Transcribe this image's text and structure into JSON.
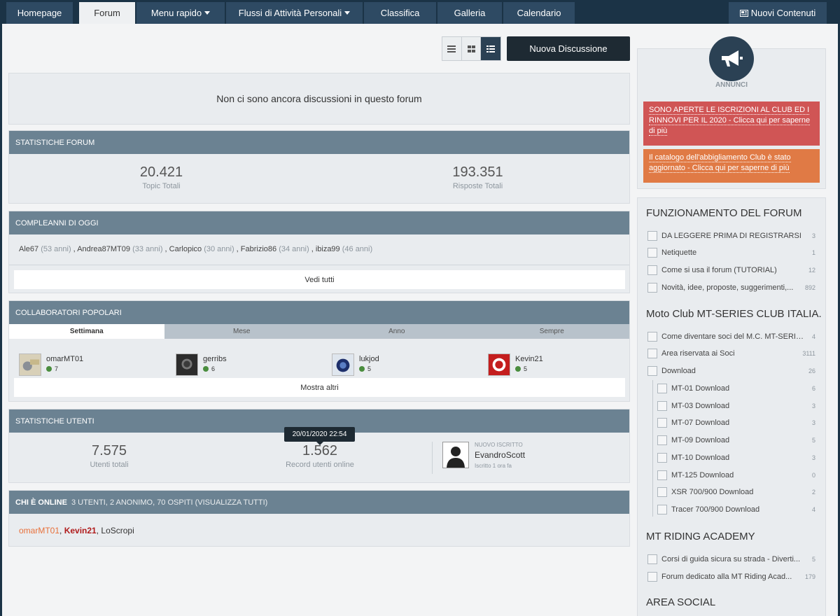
{
  "nav": {
    "tabs": [
      {
        "label": "Homepage"
      },
      {
        "label": "Forum"
      },
      {
        "label": "Menu rapido"
      },
      {
        "label": "Flussi di Attività Personali"
      },
      {
        "label": "Classifica"
      },
      {
        "label": "Galleria"
      },
      {
        "label": "Calendario"
      }
    ],
    "new_content": "Nuovi Contenuti"
  },
  "toolbar": {
    "new_topic": "Nuova Discussione"
  },
  "forum": {
    "empty_message": "Non ci sono ancora discussioni in questo forum"
  },
  "stats": {
    "title": "Statistiche forum",
    "topics_value": "20.421",
    "topics_label": "Topic Totali",
    "replies_value": "193.351",
    "replies_label": "Risposte Totali"
  },
  "birthdays": {
    "title": "Compleanni di oggi",
    "people": [
      {
        "name": "Ale67",
        "age": "(53 anni)"
      },
      {
        "name": "Andrea87MT09",
        "age": "(33 anni)"
      },
      {
        "name": "Carlopico",
        "age": "(30 anni)"
      },
      {
        "name": "Fabrizio86",
        "age": "(34 anni)"
      },
      {
        "name": "ibiza99",
        "age": "(46 anni)"
      }
    ],
    "see_all": "Vedi tutti"
  },
  "contributors": {
    "title": "Collaboratori popolari",
    "tabs": [
      "Settimana",
      "Mese",
      "Anno",
      "Sempre"
    ],
    "users": [
      {
        "name": "omarMT01",
        "rep": "7"
      },
      {
        "name": "gerribs",
        "rep": "6"
      },
      {
        "name": "lukjod",
        "rep": "5"
      },
      {
        "name": "Kevin21",
        "rep": "5"
      }
    ],
    "show_more": "Mostra altri"
  },
  "user_stats": {
    "title": "Statistiche utenti",
    "total_value": "7.575",
    "total_label": "Utenti totali",
    "record_value": "1.562",
    "record_label": "Record utenti online",
    "record_tooltip": "20/01/2020 22:54",
    "new_member_label": "Nuovo iscritto",
    "new_member_name": "EvandroScott",
    "new_member_when": "Iscritto 1 ora fa"
  },
  "online": {
    "title": "Chi è online",
    "summary": "3 utenti, 2 anonimo, 70 ospiti (Visualizza tutti)",
    "users": [
      {
        "name": "omarMT01",
        "color": "#e8703a"
      },
      {
        "name": "Kevin21",
        "color": "#b01c1c"
      },
      {
        "name": "LoScropi",
        "color": "#333333"
      }
    ],
    "sep": ", "
  },
  "sidebar": {
    "announcements_title": "Annunci",
    "announcements": [
      {
        "text": "SONO APERTE LE ISCRIZIONI AL CLUB ED I RINNOVI PER IL 2020 - Clicca qui per saperne di più",
        "color": "#d05555"
      },
      {
        "text": "Il catalogo dell'abbigliamento Club è stato aggiornato - Clicca qui per saperne di più",
        "color": "#e07a45"
      }
    ],
    "categories": [
      {
        "title": "FUNZIONAMENTO DEL FORUM",
        "forums": [
          {
            "label": "DA LEGGERE PRIMA DI REGISTRARSI",
            "count": "3"
          },
          {
            "label": "Netiquette",
            "count": "1"
          },
          {
            "label": "Come si usa il forum (TUTORIAL)",
            "count": "12"
          },
          {
            "label": "Novità, idee, proposte, suggerimenti,...",
            "count": "892"
          }
        ]
      },
      {
        "title": "Moto Club MT-SERIES CLUB ITALIA...",
        "forums": [
          {
            "label": "Come diventare soci del M.C. MT-SERIES...",
            "count": "4"
          },
          {
            "label": "Area riservata ai Soci",
            "count": "3111"
          },
          {
            "label": "Download",
            "count": "26"
          },
          {
            "label": "MT-01 Download",
            "count": "6"
          },
          {
            "label": "MT-03 Download",
            "count": "3"
          },
          {
            "label": "MT-07 Download",
            "count": "3"
          },
          {
            "label": "MT-09 Download",
            "count": "5"
          },
          {
            "label": "MT-10 Download",
            "count": "3"
          },
          {
            "label": "MT-125 Download",
            "count": "0"
          },
          {
            "label": "XSR 700/900 Download",
            "count": "2"
          },
          {
            "label": "Tracer 700/900 Download",
            "count": "4"
          }
        ]
      },
      {
        "title": "MT RIDING ACADEMY",
        "forums": [
          {
            "label": "Corsi di guida sicura su strada - Diverti...",
            "count": "5"
          },
          {
            "label": "Forum dedicato alla MT Riding Acad...",
            "count": "179"
          }
        ]
      },
      {
        "title": "AREA SOCIAL"
      }
    ]
  }
}
